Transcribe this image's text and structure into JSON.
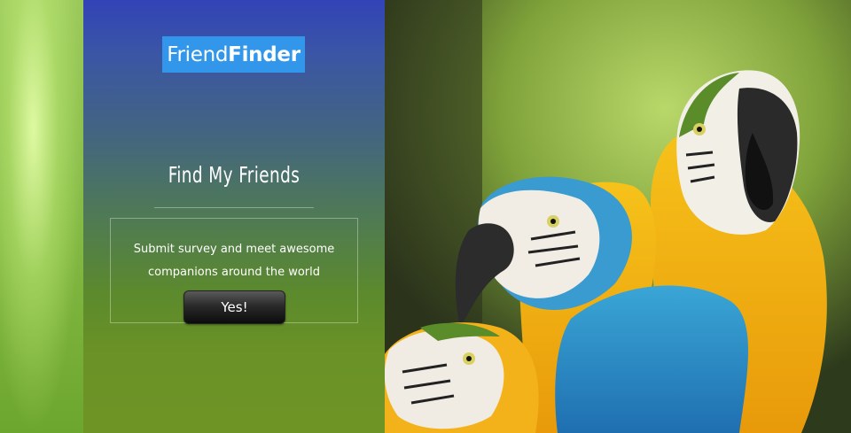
{
  "logo": {
    "light": "Friend",
    "bold": "Finder"
  },
  "hero": {
    "title": "Find My Friends",
    "description_line1": "Submit survey and meet awesome",
    "description_line2": "companions around the world",
    "button_label": "Yes!"
  },
  "photo": {
    "subject": "macaw-parrots"
  },
  "colors": {
    "logo_bg": "#3296ea",
    "panel_top": "#3243b7",
    "panel_bottom": "#6f9426"
  }
}
